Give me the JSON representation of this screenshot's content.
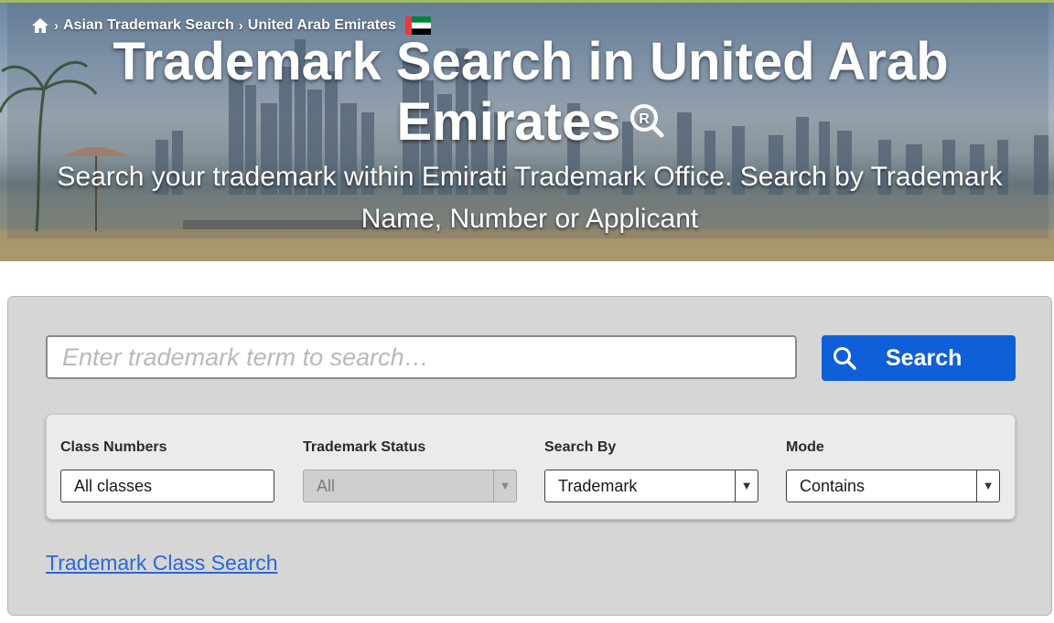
{
  "breadcrumb": {
    "home_icon": "home-icon",
    "items": [
      "Asian Trademark Search",
      "United Arab Emirates"
    ],
    "separator": "›",
    "flag": "uae-flag"
  },
  "hero": {
    "title": "Trademark Search in United Arab Emirates",
    "title_icon": "registered-search-icon",
    "subtitle": "Search your trademark within Emirati Trademark Office. Search by Trademark Name, Number or Applicant"
  },
  "search": {
    "placeholder": "Enter trademark term to search…",
    "button_label": "Search",
    "button_icon": "search-icon",
    "button_color": "#0f5fd8"
  },
  "filters": [
    {
      "label": "Class Numbers",
      "value": "All classes",
      "type": "text",
      "disabled": false
    },
    {
      "label": "Trademark Status",
      "value": "All",
      "type": "select",
      "disabled": true
    },
    {
      "label": "Search By",
      "value": "Trademark",
      "type": "select",
      "disabled": false
    },
    {
      "label": "Mode",
      "value": "Contains",
      "type": "select",
      "disabled": false
    }
  ],
  "links": {
    "class_search": "Trademark Class Search"
  }
}
